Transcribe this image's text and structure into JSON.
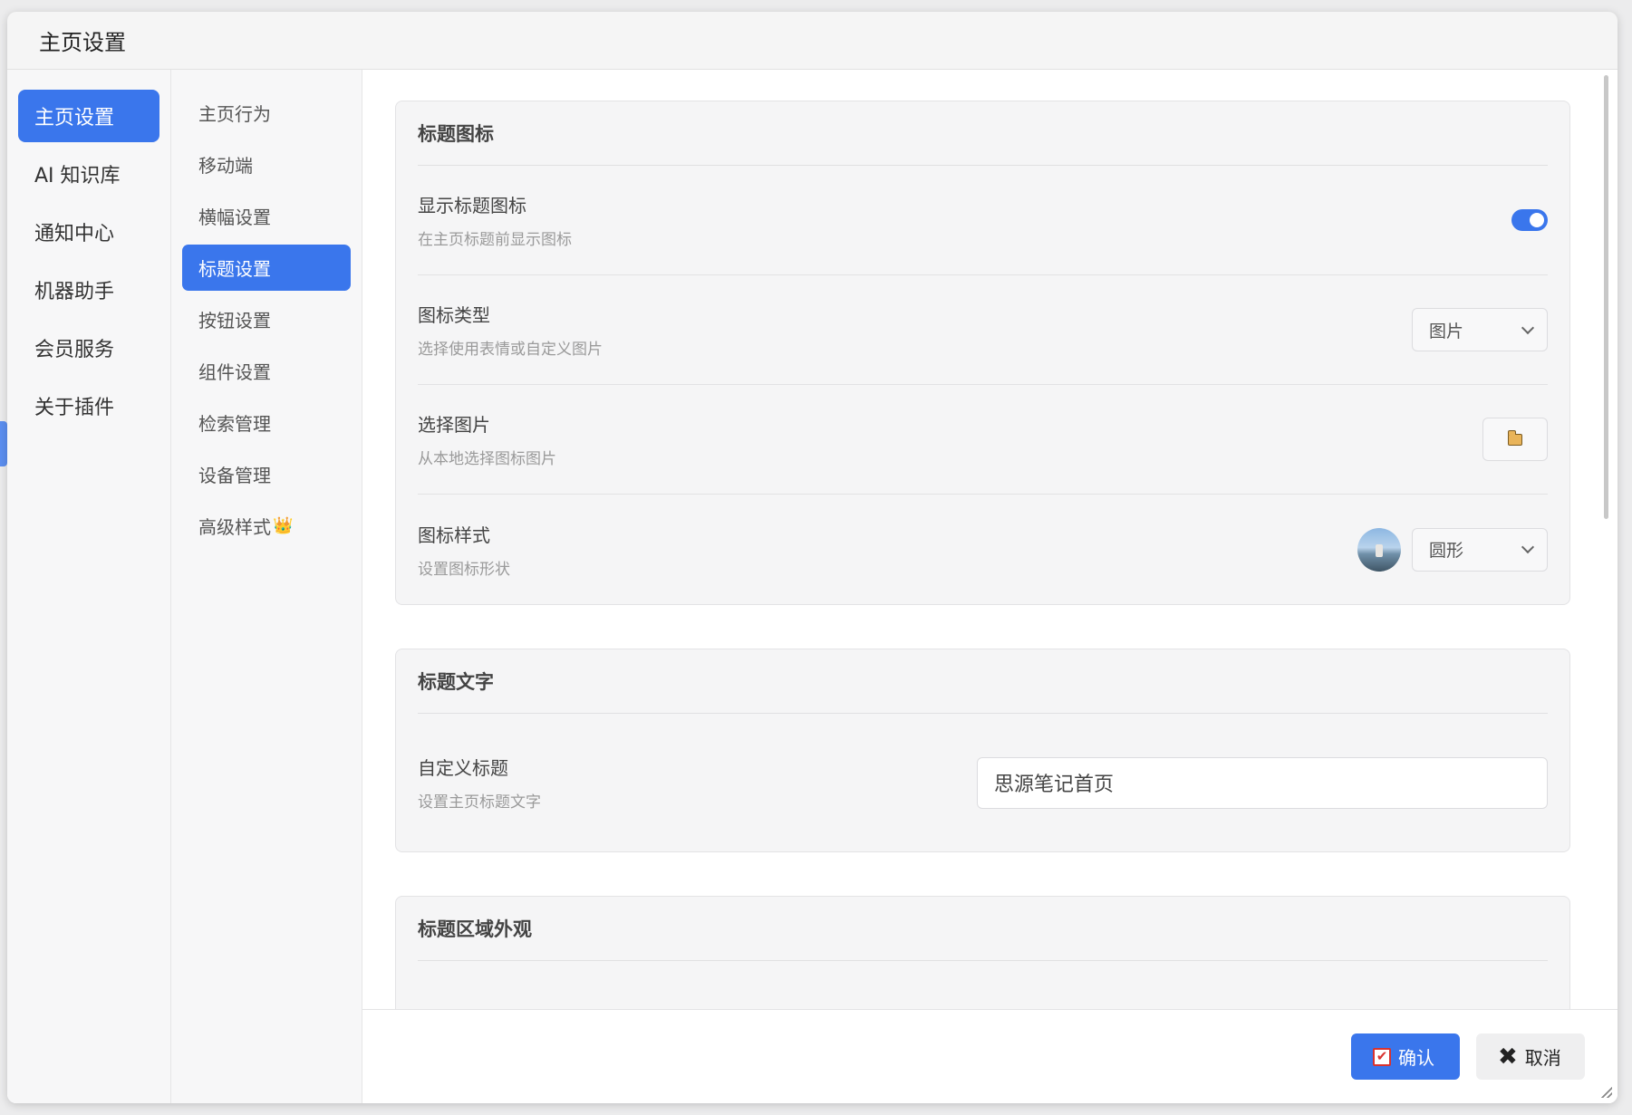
{
  "dialog": {
    "title": "主页设置"
  },
  "nav_primary": [
    {
      "label": "主页设置",
      "active": true
    },
    {
      "label": "AI 知识库",
      "active": false
    },
    {
      "label": "通知中心",
      "active": false
    },
    {
      "label": "机器助手",
      "active": false
    },
    {
      "label": "会员服务",
      "active": false
    },
    {
      "label": "关于插件",
      "active": false
    }
  ],
  "nav_secondary": [
    {
      "label": "主页行为",
      "active": false
    },
    {
      "label": "移动端",
      "active": false
    },
    {
      "label": "横幅设置",
      "active": false
    },
    {
      "label": "标题设置",
      "active": true
    },
    {
      "label": "按钮设置",
      "active": false
    },
    {
      "label": "组件设置",
      "active": false
    },
    {
      "label": "检索管理",
      "active": false
    },
    {
      "label": "设备管理",
      "active": false
    },
    {
      "label": "高级样式",
      "active": false,
      "badge": "👑"
    }
  ],
  "sections": {
    "title_icon": {
      "heading": "标题图标",
      "show_icon": {
        "label": "显示标题图标",
        "desc": "在主页标题前显示图标",
        "enabled": true
      },
      "icon_type": {
        "label": "图标类型",
        "desc": "选择使用表情或自定义图片",
        "value": "图片"
      },
      "choose_image": {
        "label": "选择图片",
        "desc": "从本地选择图标图片"
      },
      "icon_style": {
        "label": "图标样式",
        "desc": "设置图标形状",
        "value": "圆形"
      }
    },
    "title_text": {
      "heading": "标题文字",
      "custom_title": {
        "label": "自定义标题",
        "desc": "设置主页标题文字",
        "value": "思源笔记首页"
      }
    },
    "title_area": {
      "heading": "标题区域外观"
    }
  },
  "footer": {
    "confirm_label": "确认",
    "cancel_label": "取消"
  },
  "colors": {
    "accent": "#3a76ec",
    "check_red": "#d8322f"
  }
}
